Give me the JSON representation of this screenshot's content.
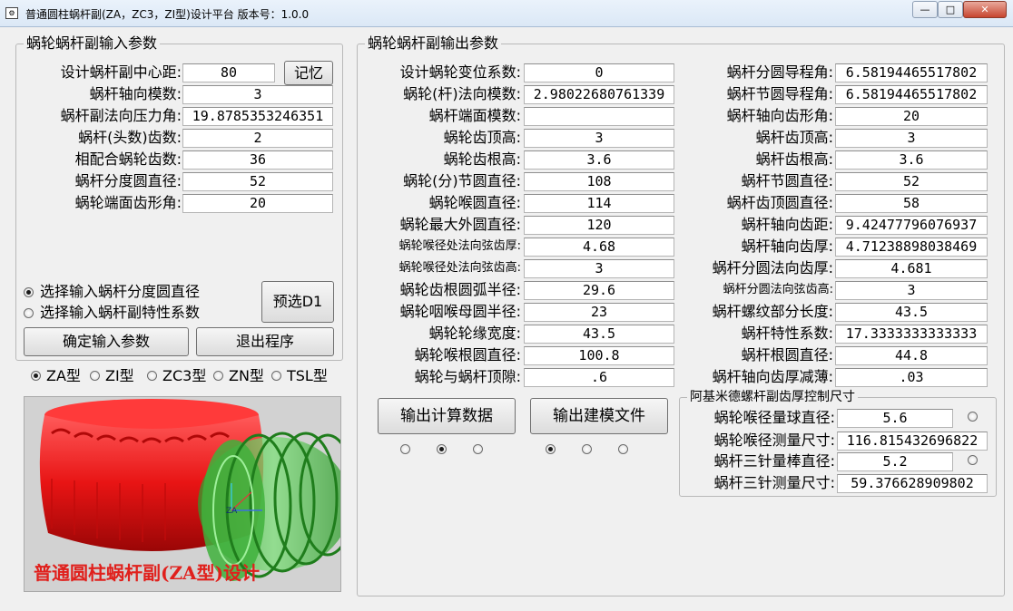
{
  "window": {
    "title": "普通圆柱蜗杆副(ZA，ZC3，ZI型)设计平台 版本号：1.0.0",
    "min": "—",
    "max": "□",
    "close": "✕"
  },
  "input": {
    "title": "蜗轮蜗杆副输入参数",
    "center_distance_label": "设计蜗杆副中心距:",
    "center_distance": "80",
    "memory_button": "记忆",
    "axial_module_label": "蜗杆轴向模数:",
    "axial_module": "3",
    "normal_pressure_angle_label": "蜗杆副法向压力角:",
    "normal_pressure_angle": "19.8785353246351",
    "worm_starts_label": "蜗杆(头数)齿数:",
    "worm_starts": "2",
    "wheel_teeth_label": "相配合蜗轮齿数:",
    "wheel_teeth": "36",
    "worm_ref_diameter_label": "蜗杆分度圆直径:",
    "worm_ref_diameter": "52",
    "wheel_transverse_angle_label": "蜗轮端面齿形角:",
    "wheel_transverse_angle": "20",
    "option_diameter": "选择输入蜗杆分度圆直径",
    "option_coefficient": "选择输入蜗杆副特性系数",
    "preselect_button": "预选D1",
    "confirm_button": "确定输入参数",
    "exit_button": "退出程序"
  },
  "types": {
    "za": "ZA型",
    "zi": "ZI型",
    "zc3": "ZC3型",
    "zn": "ZN型",
    "tsl": "TSL型"
  },
  "preview": {
    "caption": "普通圆柱蜗杆副(ZA型)设计",
    "axis_label": "ZA"
  },
  "output": {
    "title": "蜗轮蜗杆副输出参数",
    "left": [
      {
        "label": "设计蜗轮变位系数:",
        "value": "0",
        "small": false
      },
      {
        "label": "蜗轮(杆)法向模数:",
        "value": "2.98022680761339",
        "small": false
      },
      {
        "label": "蜗杆端面模数:",
        "value": "",
        "small": false
      },
      {
        "label": "蜗轮齿顶高:",
        "value": "3",
        "small": false
      },
      {
        "label": "蜗轮齿根高:",
        "value": "3.6",
        "small": false
      },
      {
        "label": "蜗轮(分)节圆直径:",
        "value": "108",
        "small": false
      },
      {
        "label": "蜗轮喉圆直径:",
        "value": "114",
        "small": false
      },
      {
        "label": "蜗轮最大外圆直径:",
        "value": "120",
        "small": false
      },
      {
        "label": "蜗轮喉径处法向弦齿厚:",
        "value": "4.68",
        "small": true
      },
      {
        "label": "蜗轮喉径处法向弦齿高:",
        "value": "3",
        "small": true
      },
      {
        "label": "蜗轮齿根圆弧半径:",
        "value": "29.6",
        "small": false
      },
      {
        "label": "蜗轮咽喉母圆半径:",
        "value": "23",
        "small": false
      },
      {
        "label": "蜗轮轮缘宽度:",
        "value": "43.5",
        "small": false
      },
      {
        "label": "蜗轮喉根圆直径:",
        "value": "100.8",
        "small": false
      },
      {
        "label": "蜗轮与蜗杆顶隙:",
        "value": ".6",
        "small": false
      }
    ],
    "right": [
      {
        "label": "蜗杆分圆导程角:",
        "value": "6.58194465517802",
        "small": false
      },
      {
        "label": "蜗杆节圆导程角:",
        "value": "6.58194465517802",
        "small": false
      },
      {
        "label": "蜗杆轴向齿形角:",
        "value": "20",
        "small": false
      },
      {
        "label": "蜗杆齿顶高:",
        "value": "3",
        "small": false
      },
      {
        "label": "蜗杆齿根高:",
        "value": "3.6",
        "small": false
      },
      {
        "label": "蜗杆节圆直径:",
        "value": "52",
        "small": false
      },
      {
        "label": "蜗杆齿顶圆直径:",
        "value": "58",
        "small": false
      },
      {
        "label": "蜗杆轴向齿距:",
        "value": "9.42477796076937",
        "small": false
      },
      {
        "label": "蜗杆轴向齿厚:",
        "value": "4.71238898038469",
        "small": false
      },
      {
        "label": "蜗杆分圆法向齿厚:",
        "value": "4.681",
        "small": false
      },
      {
        "label": "蜗杆分圆法向弦齿高:",
        "value": "3",
        "small": true
      },
      {
        "label": "蜗杆螺纹部分长度:",
        "value": "43.5",
        "small": false
      },
      {
        "label": "蜗杆特性系数:",
        "value": "17.3333333333333",
        "small": false
      },
      {
        "label": "蜗杆根圆直径:",
        "value": "44.8",
        "small": false
      },
      {
        "label": "蜗杆轴向齿厚减薄:",
        "value": ".03",
        "small": false
      }
    ],
    "calc_button": "输出计算数据",
    "model_button": "输出建模文件"
  },
  "archimedes": {
    "title": "阿基米德螺杆副齿厚控制尺寸",
    "ball_diameter_label": "蜗轮喉径量球直径:",
    "ball_diameter": "5.6",
    "ball_measure_label": "蜗轮喉径测量尺寸:",
    "ball_measure": "116.815432696822",
    "pin_diameter_label": "蜗杆三针量棒直径:",
    "pin_diameter": "5.2",
    "pin_measure_label": "蜗杆三针测量尺寸:",
    "pin_measure": "59.376628909802"
  },
  "colors": {
    "wheel": "#ee1c1c",
    "worm": "#4cc64a",
    "caption": "#e0201c"
  }
}
